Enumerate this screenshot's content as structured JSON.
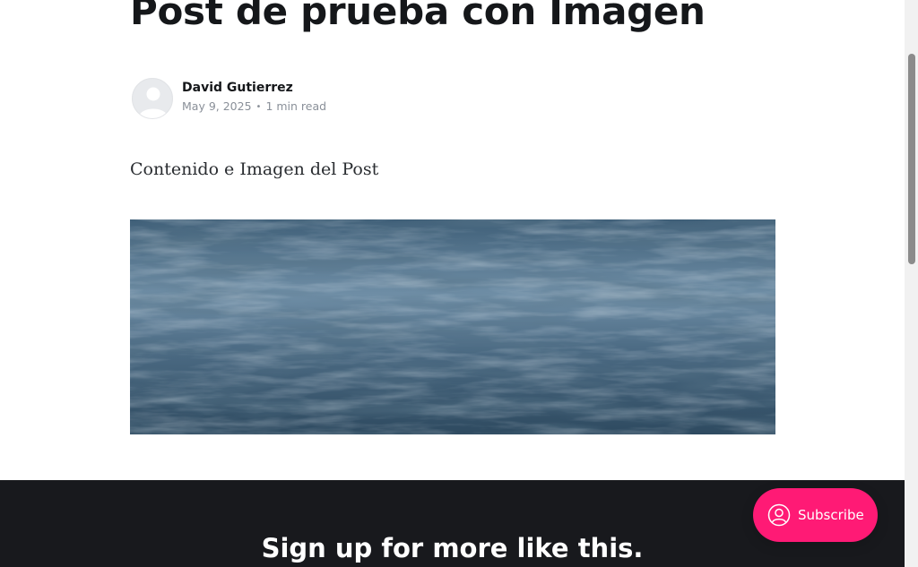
{
  "post": {
    "title": "Post de prueba con Imagen",
    "author": "David Gutierrez",
    "date": "May 9, 2025",
    "separator": "•",
    "read_time": "1 min read",
    "content": "Contenido e Imagen del Post"
  },
  "signup": {
    "title": "Sign up for more like this."
  },
  "subscribe": {
    "label": "Subscribe",
    "icon": "user-circle-icon"
  },
  "colors": {
    "accent": "#ff1a75",
    "footer_bg": "#18191d",
    "text": "#15171a",
    "muted": "#8a9099"
  }
}
